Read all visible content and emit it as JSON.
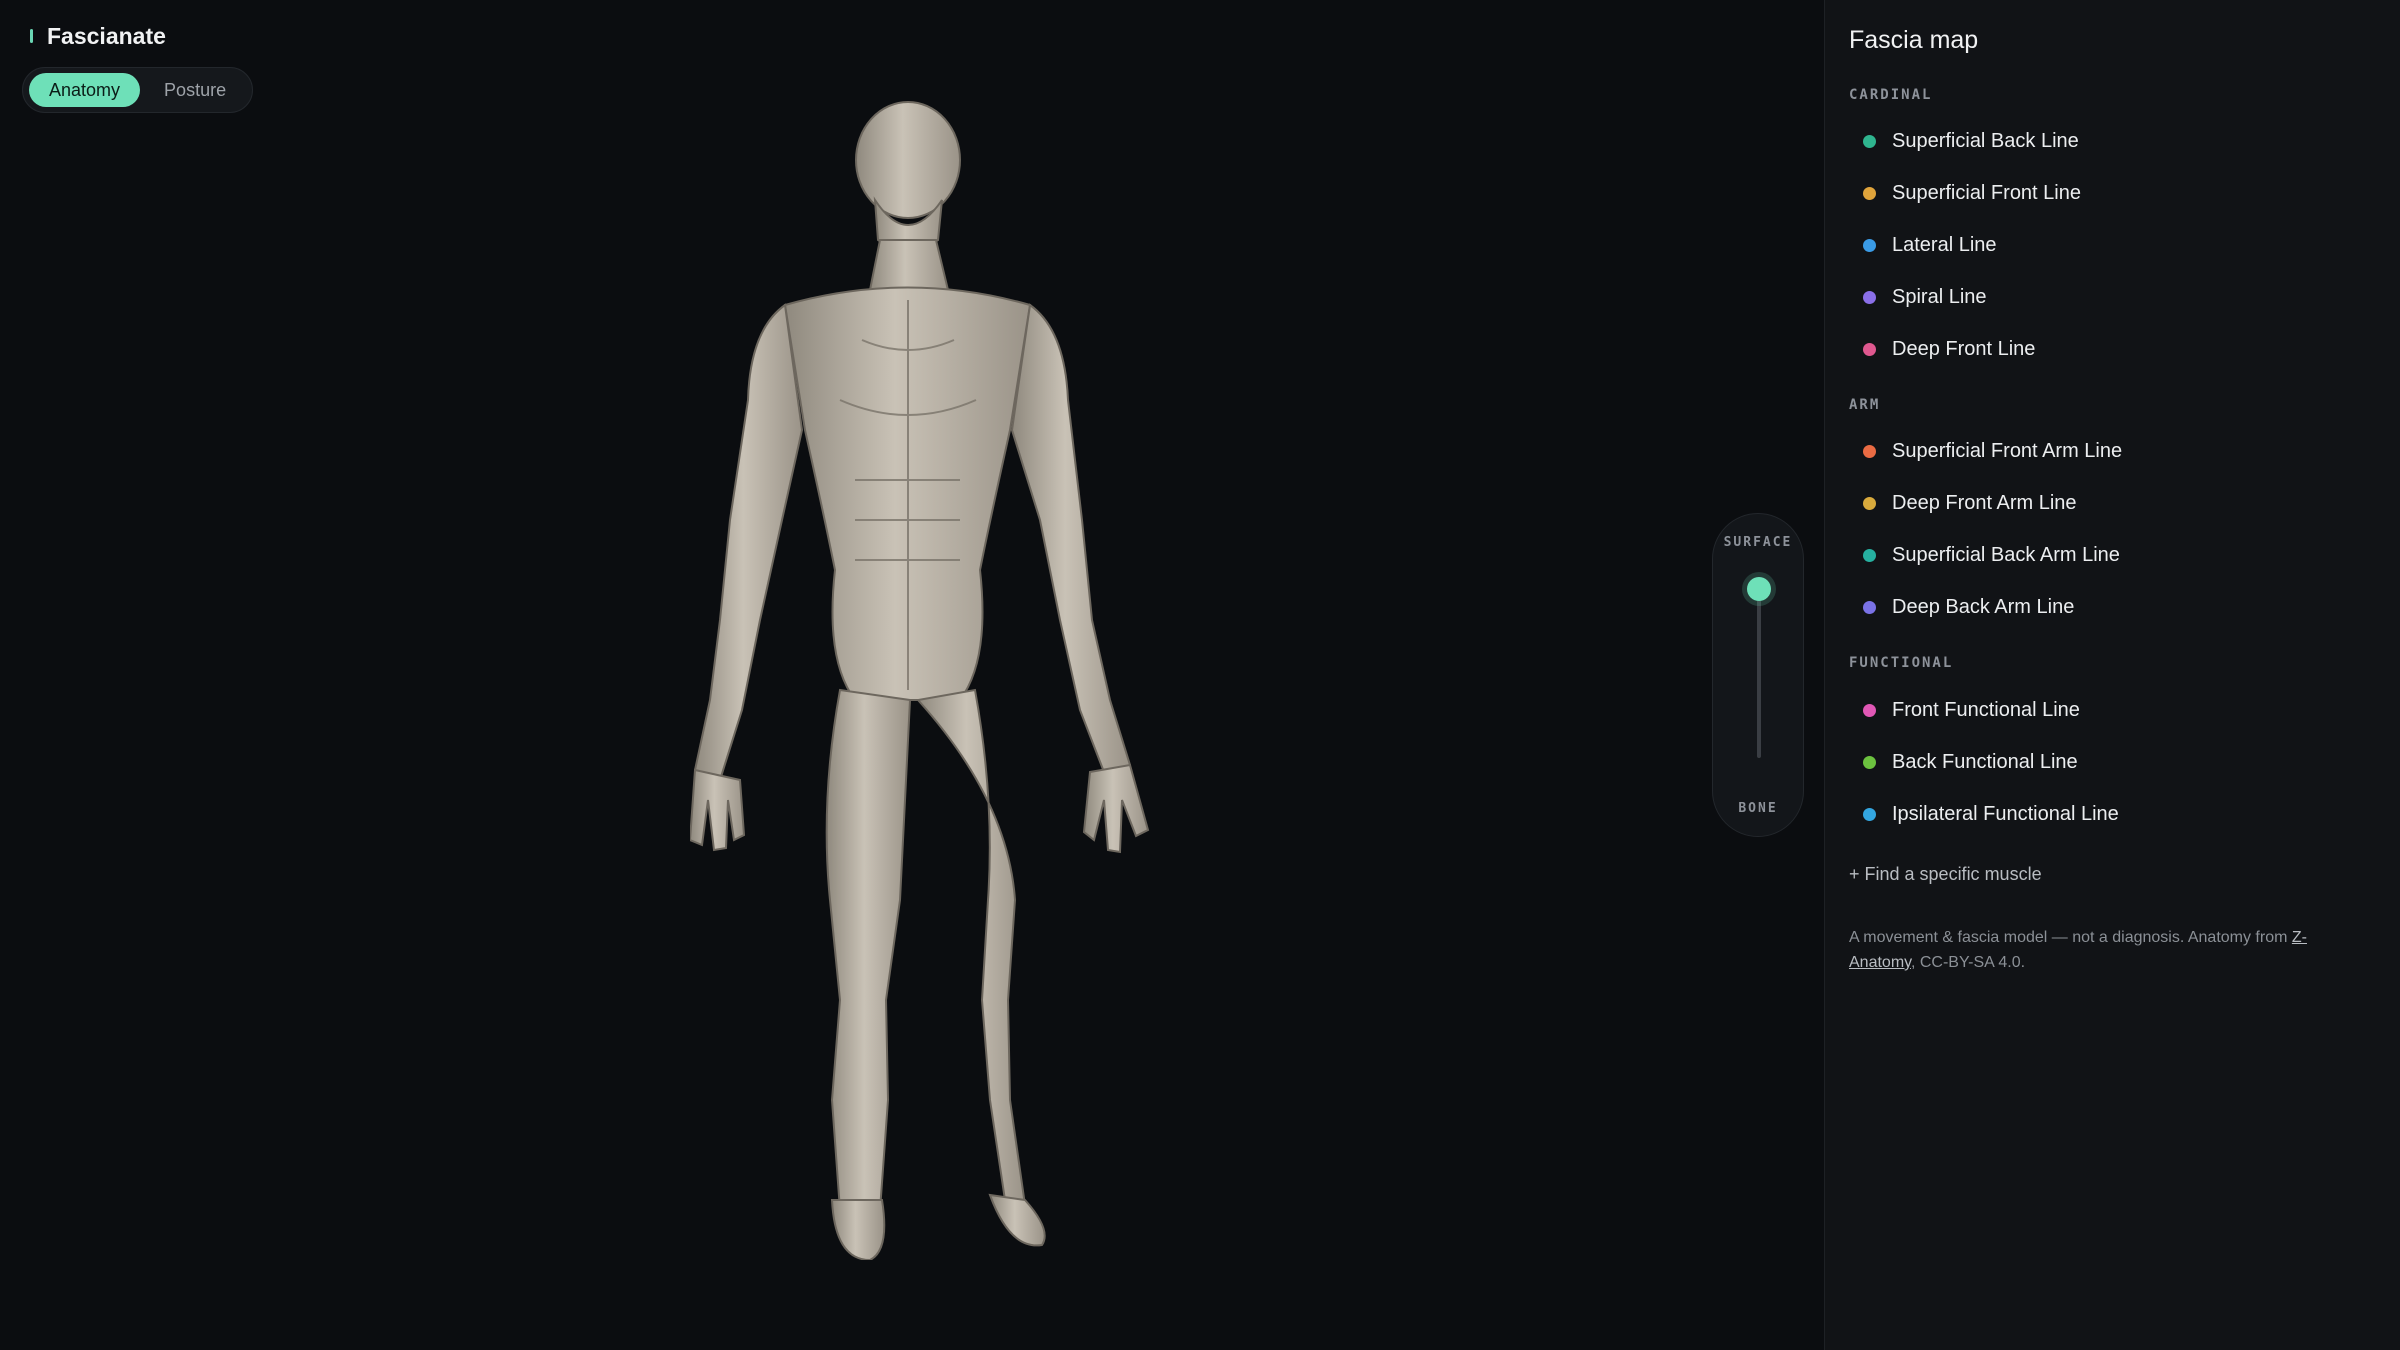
{
  "app": {
    "name": "Fascianate"
  },
  "mode_toggle": {
    "options": [
      "Anatomy",
      "Posture"
    ],
    "selected": "Anatomy"
  },
  "depth_slider": {
    "top_label": "SURFACE",
    "bottom_label": "BONE",
    "value": 1.0
  },
  "panel": {
    "title": "Fascia map",
    "groups": [
      {
        "label": "CARDINAL",
        "items": [
          {
            "label": "Superficial Back Line",
            "color": "#2fb58f"
          },
          {
            "label": "Superficial Front Line",
            "color": "#e0a43b"
          },
          {
            "label": "Lateral Line",
            "color": "#3a9be6"
          },
          {
            "label": "Spiral Line",
            "color": "#8a6fe8"
          },
          {
            "label": "Deep Front Line",
            "color": "#e0588f"
          }
        ]
      },
      {
        "label": "ARM",
        "items": [
          {
            "label": "Superficial Front Arm Line",
            "color": "#ea6b43"
          },
          {
            "label": "Deep Front Arm Line",
            "color": "#d9aa3c"
          },
          {
            "label": "Superficial Back Arm Line",
            "color": "#26b0a0"
          },
          {
            "label": "Deep Back Arm Line",
            "color": "#7a72e6"
          }
        ]
      },
      {
        "label": "FUNCTIONAL",
        "items": [
          {
            "label": "Front Functional Line",
            "color": "#e057b5"
          },
          {
            "label": "Back Functional Line",
            "color": "#6cc23f"
          },
          {
            "label": "Ipsilateral Functional Line",
            "color": "#33a6e0"
          }
        ]
      }
    ],
    "find_link": "+ Find a specific muscle",
    "footnote": {
      "pre": "A movement & fascia model — not a diagnosis. Anatomy from ",
      "link": "Z-Anatomy",
      "post": ", CC-BY-SA 4.0."
    }
  },
  "colors": {
    "accent": "#6ee0b8",
    "background": "#0b0d10",
    "panel": "#111316"
  }
}
